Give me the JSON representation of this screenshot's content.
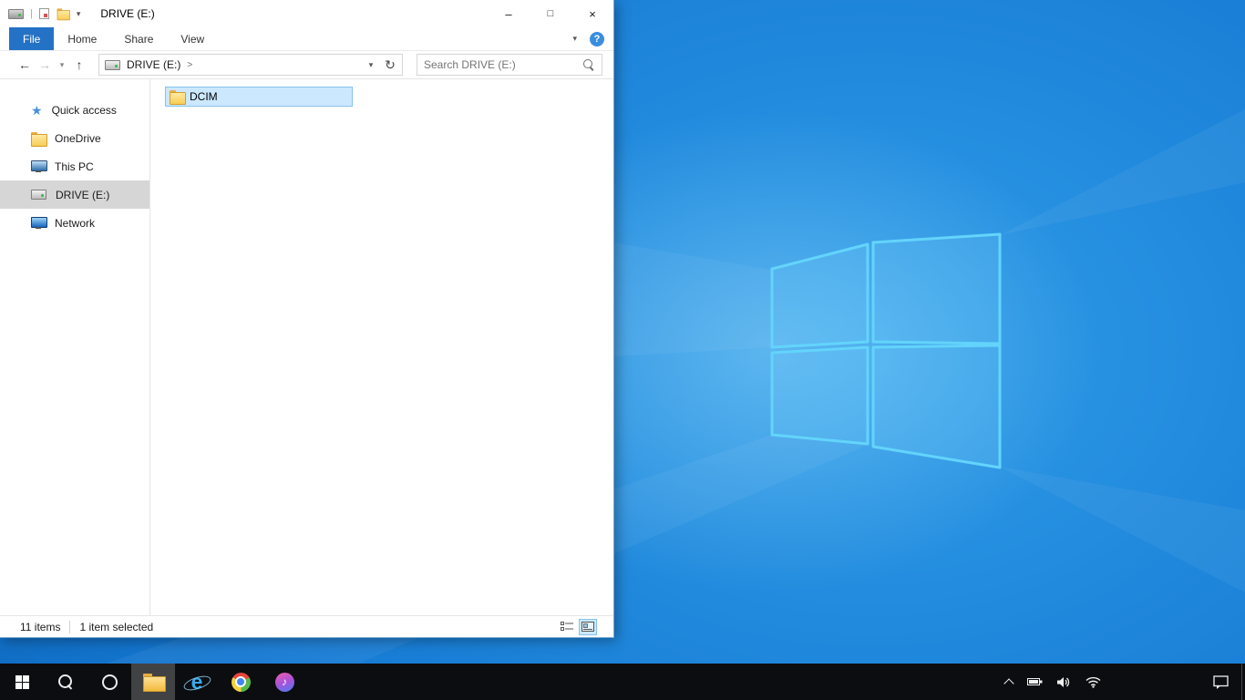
{
  "colors": {
    "accent_file_tab": "#2472c6",
    "selection_bg": "#cce8ff",
    "selection_border": "#84c3ea",
    "sidebar_selected_bg": "#d6d6d6",
    "taskbar_bg": "#0c0d10",
    "desktop_center": "#2f9ce8",
    "desktop_edge": "#0a5cac",
    "logo_stroke": "#63d4fb"
  },
  "explorer": {
    "title": "DRIVE (E:)",
    "tabs": [
      {
        "label": "File"
      },
      {
        "label": "Home"
      },
      {
        "label": "Share"
      },
      {
        "label": "View"
      }
    ],
    "breadcrumb": {
      "location": "DRIVE (E:)",
      "separator": ">"
    },
    "search": {
      "placeholder": "Search DRIVE (E:)"
    },
    "sidebar": {
      "items": [
        {
          "label": "Quick access"
        },
        {
          "label": "OneDrive"
        },
        {
          "label": "This PC"
        },
        {
          "label": "DRIVE (E:)",
          "selected": true
        },
        {
          "label": "Network"
        }
      ]
    },
    "files": [
      {
        "name": "DCIM",
        "selected": true
      }
    ],
    "status": {
      "items_count": "11 items",
      "selected_count": "1 item selected"
    }
  },
  "icons": {
    "back": "←",
    "forward": "→",
    "up": "↑",
    "dropdown": "▾",
    "refresh": "↻",
    "minimize": "–",
    "maximize": "□",
    "close": "×",
    "help": "?",
    "star": "★",
    "music_note": "♪",
    "ie_letter": "e",
    "qat_divider": "|"
  },
  "taskbar": {
    "buttons": [
      {
        "name": "start"
      },
      {
        "name": "search"
      },
      {
        "name": "cortana"
      },
      {
        "name": "file-explorer",
        "active": true
      },
      {
        "name": "internet-explorer"
      },
      {
        "name": "chrome"
      },
      {
        "name": "itunes"
      }
    ],
    "tray": [
      "hidden-icons",
      "battery",
      "volume",
      "network"
    ],
    "action_center": "action-center"
  }
}
